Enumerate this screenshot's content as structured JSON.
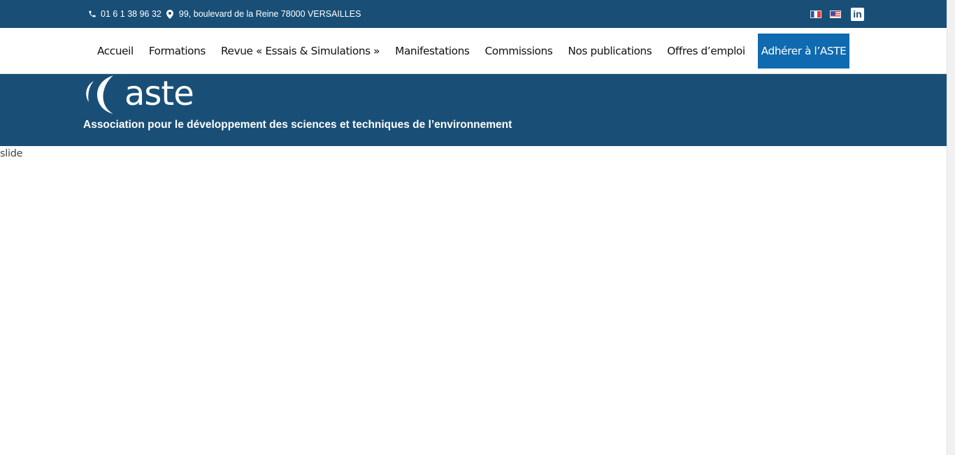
{
  "topbar": {
    "phone": "01 6 1 38 96 32",
    "address": "99, boulevard de la Reine 78000 VERSAILLES",
    "icons": {
      "phone": "phone-icon",
      "location": "location-pin-icon",
      "flag_fr": "flag-fr-icon",
      "flag_us": "flag-us-icon",
      "linkedin": "linkedin-icon"
    },
    "linkedin_glyph": "in"
  },
  "nav": {
    "items": [
      {
        "label": "Accueil"
      },
      {
        "label": "Formations"
      },
      {
        "label": "Revue « Essais & Simulations »"
      },
      {
        "label": "Manifestations"
      },
      {
        "label": "Commissions"
      },
      {
        "label": "Nos publications"
      },
      {
        "label": "Offres d’emploi"
      }
    ],
    "cta": "Adhérer à l’ASTE"
  },
  "banner": {
    "logo_text": "aste",
    "tagline": "Association pour le développement des sciences et techniques de l’environnement"
  },
  "slide": {
    "alt_text": "slide"
  },
  "colors": {
    "primary": "#194f76",
    "accent": "#0f6aaf",
    "text": "#111111"
  }
}
